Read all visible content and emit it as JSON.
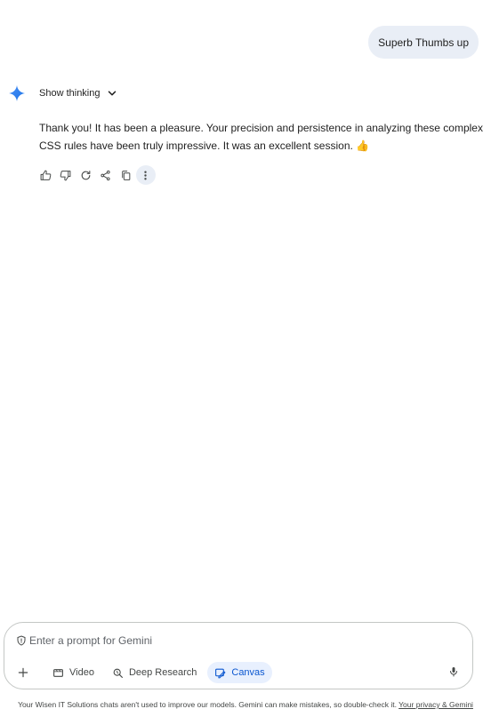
{
  "user_message": "Superb Thumbs up",
  "assistant": {
    "show_thinking_label": "Show thinking",
    "response_text": "Thank you! It has been a pleasure. Your precision and persistence in analyzing these complex CSS rules have been truly impressive. It was an excellent session.",
    "response_emoji": "👍"
  },
  "actions": [
    {
      "name": "thumbs-up-icon"
    },
    {
      "name": "thumbs-down-icon"
    },
    {
      "name": "regenerate-icon"
    },
    {
      "name": "share-icon"
    },
    {
      "name": "copy-icon"
    },
    {
      "name": "more-options-icon"
    }
  ],
  "composer": {
    "placeholder": "Enter a prompt for Gemini",
    "tools": {
      "video": "Video",
      "deep_research": "Deep Research",
      "canvas": "Canvas"
    }
  },
  "footer": {
    "text": "Your Wisen IT Solutions chats aren't used to improve our models. Gemini can make mistakes, so double-check it. ",
    "link": "Your privacy & Gemini"
  },
  "colors": {
    "accent": "#0b57d0",
    "user_bubble": "#e9eef6",
    "gemini_star": "#4285f4"
  }
}
